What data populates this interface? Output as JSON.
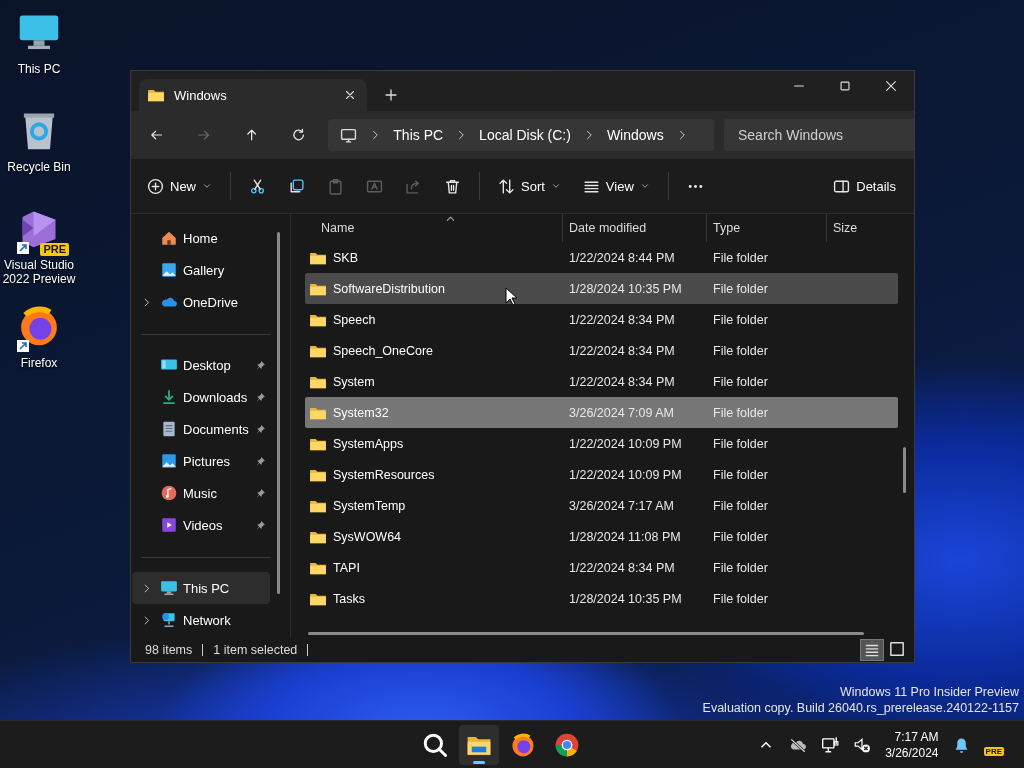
{
  "desktop_icons": [
    {
      "label": "This PC",
      "shortcut": false
    },
    {
      "label": "Recycle Bin",
      "shortcut": false
    },
    {
      "label": "Visual Studio 2022 Preview",
      "shortcut": true,
      "badge": "PRE"
    },
    {
      "label": "Firefox",
      "shortcut": true
    }
  ],
  "window": {
    "tabs": [
      {
        "title": "Windows",
        "selected": true
      }
    ]
  },
  "nav": [
    {
      "kind": "back",
      "disabled": false
    },
    {
      "kind": "forward",
      "disabled": true
    },
    {
      "kind": "up",
      "disabled": false
    },
    {
      "kind": "refresh",
      "disabled": false
    }
  ],
  "address_bar": {
    "crumbs": [
      "This PC",
      "Local Disk (C:)",
      "Windows"
    ]
  },
  "search": {
    "placeholder": "Search Windows"
  },
  "toolbar_groups": [
    [
      {
        "kind": "new",
        "label": "New",
        "disabled": false
      }
    ],
    [
      {
        "kind": "cut",
        "disabled": false
      },
      {
        "kind": "copy",
        "disabled": false
      },
      {
        "kind": "paste",
        "disabled": true
      },
      {
        "kind": "rename",
        "disabled": true
      },
      {
        "kind": "share",
        "disabled": true
      },
      {
        "kind": "delete",
        "disabled": false
      }
    ],
    [
      {
        "kind": "sort",
        "label": "Sort",
        "disabled": false
      },
      {
        "kind": "view",
        "label": "View",
        "disabled": false
      }
    ],
    [
      {
        "kind": "more",
        "disabled": false
      }
    ]
  ],
  "details_button": {
    "label": "Details"
  },
  "sidebar": {
    "groups": [
      [
        {
          "label": "Home",
          "expandable": false,
          "pinned": false,
          "selected": false
        },
        {
          "label": "Gallery",
          "expandable": false,
          "pinned": false,
          "selected": false
        },
        {
          "label": "OneDrive",
          "expandable": true,
          "pinned": false,
          "selected": false
        }
      ],
      [
        {
          "label": "Desktop",
          "expandable": false,
          "pinned": true,
          "selected": false
        },
        {
          "label": "Downloads",
          "expandable": false,
          "pinned": true,
          "selected": false
        },
        {
          "label": "Documents",
          "expandable": false,
          "pinned": true,
          "selected": false
        },
        {
          "label": "Pictures",
          "expandable": false,
          "pinned": true,
          "selected": false
        },
        {
          "label": "Music",
          "expandable": false,
          "pinned": true,
          "selected": false
        },
        {
          "label": "Videos",
          "expandable": false,
          "pinned": true,
          "selected": false
        }
      ],
      [
        {
          "label": "This PC",
          "expandable": true,
          "pinned": false,
          "selected": true
        },
        {
          "label": "Network",
          "expandable": true,
          "pinned": false,
          "selected": false
        }
      ]
    ]
  },
  "file_list": {
    "columns": [
      {
        "label": "Name",
        "sorted": true
      },
      {
        "label": "Date modified",
        "sorted": false
      },
      {
        "label": "Type",
        "sorted": false
      },
      {
        "label": "Size",
        "sorted": false
      }
    ],
    "rows": [
      {
        "name": "SKB",
        "date": "1/22/2024 8:44 PM",
        "type": "File folder",
        "selected": false,
        "hovered": false
      },
      {
        "name": "SoftwareDistribution",
        "date": "1/28/2024 10:35 PM",
        "type": "File folder",
        "selected": false,
        "hovered": true
      },
      {
        "name": "Speech",
        "date": "1/22/2024 8:34 PM",
        "type": "File folder",
        "selected": false,
        "hovered": false
      },
      {
        "name": "Speech_OneCore",
        "date": "1/22/2024 8:34 PM",
        "type": "File folder",
        "selected": false,
        "hovered": false
      },
      {
        "name": "System",
        "date": "1/22/2024 8:34 PM",
        "type": "File folder",
        "selected": false,
        "hovered": false
      },
      {
        "name": "System32",
        "date": "3/26/2024 7:09 AM",
        "type": "File folder",
        "selected": true,
        "hovered": false
      },
      {
        "name": "SystemApps",
        "date": "1/22/2024 10:09 PM",
        "type": "File folder",
        "selected": false,
        "hovered": false
      },
      {
        "name": "SystemResources",
        "date": "1/22/2024 10:09 PM",
        "type": "File folder",
        "selected": false,
        "hovered": false
      },
      {
        "name": "SystemTemp",
        "date": "3/26/2024 7:17 AM",
        "type": "File folder",
        "selected": false,
        "hovered": false
      },
      {
        "name": "SysWOW64",
        "date": "1/28/2024 11:08 PM",
        "type": "File folder",
        "selected": false,
        "hovered": false
      },
      {
        "name": "TAPI",
        "date": "1/22/2024 8:34 PM",
        "type": "File folder",
        "selected": false,
        "hovered": false
      },
      {
        "name": "Tasks",
        "date": "1/28/2024 10:35 PM",
        "type": "File folder",
        "selected": false,
        "hovered": false
      }
    ]
  },
  "status_bar": {
    "item_count": "98 items",
    "selection": "1 item selected",
    "views": [
      {
        "kind": "details",
        "selected": true
      },
      {
        "kind": "tiles",
        "selected": false
      }
    ]
  },
  "desktop_notice": [
    "Windows 11 Pro Insider Preview",
    "Evaluation copy. Build 26040.rs_prerelease.240122-1157"
  ],
  "taskbar": {
    "apps": [
      {
        "kind": "search",
        "active": false
      },
      {
        "kind": "explorer",
        "active": true
      },
      {
        "kind": "firefox",
        "active": false
      },
      {
        "kind": "chrome",
        "active": false
      }
    ],
    "tray": [
      {
        "kind": "chevron"
      },
      {
        "kind": "cloud-off"
      },
      {
        "kind": "network"
      },
      {
        "kind": "volume-muted"
      }
    ],
    "time": "7:17 AM",
    "date": "3/26/2024",
    "badge": "PRE"
  }
}
